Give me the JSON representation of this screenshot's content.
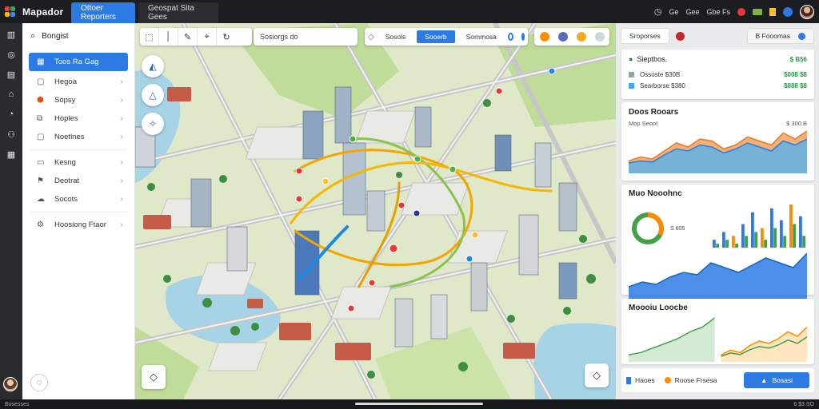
{
  "app": {
    "title": "Mapador"
  },
  "tabs": [
    {
      "label": "Ottoer Reporters",
      "active": true
    },
    {
      "label": "Geospat Sita  Gees",
      "active": false
    }
  ],
  "topbar_right": {
    "item1": "Ge",
    "item2": "Gee",
    "item3": "Gbe Fs"
  },
  "sidebar": {
    "search_label": "Bongist",
    "items": [
      {
        "label": "Toos Ra Gag",
        "icon": "grid-icon",
        "active": true
      },
      {
        "label": "Hegoa",
        "icon": "square-icon",
        "active": false
      },
      {
        "label": "Sopsy",
        "icon": "badge-icon",
        "active": false
      },
      {
        "label": "Hoples",
        "icon": "layers-icon",
        "active": false
      },
      {
        "label": "Noetlnes",
        "icon": "square-icon",
        "active": false
      },
      {
        "label": "Kesng",
        "icon": "square-icon",
        "active": false
      },
      {
        "label": "Deotrat",
        "icon": "flag-icon",
        "active": false
      },
      {
        "label": "Socots",
        "icon": "cloud-icon",
        "active": false
      },
      {
        "label": "Hoosiong Ftaor",
        "icon": "gear-icon",
        "active": false
      }
    ]
  },
  "map": {
    "search_placeholder": "Sosiorgs do",
    "seg_left": "Sosols",
    "seg_active": "Sooerb",
    "seg_right": "Sommosa"
  },
  "right_panel": {
    "header_btn": "Sroporses",
    "header_right": "B Fooomas",
    "card1": {
      "title": "Sieptbos.",
      "badge": "$ B56",
      "rows": [
        {
          "label": "Ossoste  $30B",
          "value": "$008 $8"
        },
        {
          "label": "Searborse $380",
          "value": "$888 $8"
        }
      ]
    },
    "card2": {
      "title": "Doos Rooars",
      "sub": "Mop Seoot",
      "value": "$ 300 B"
    },
    "card3": {
      "title": "Muo Nooohnc",
      "donut_label": "S 605"
    },
    "card4": {
      "title": "Moooiu Loocbe"
    },
    "footer": {
      "left": "Haoes",
      "middle": "Roose Frsesa",
      "primary": "Bosasi"
    }
  },
  "bottombar": {
    "left": "Bosesses",
    "right": "6 $3 SO"
  },
  "chart_data": [
    {
      "type": "area",
      "title": "Doos Rooars",
      "series": [
        {
          "values": [
            10,
            14,
            12,
            20,
            28,
            24,
            32,
            30,
            22,
            26,
            34,
            30,
            26,
            38,
            32,
            40
          ]
        },
        {
          "values": [
            8,
            10,
            9,
            16,
            22,
            20,
            26,
            24,
            18,
            22,
            28,
            24,
            20,
            30,
            26,
            32
          ]
        }
      ]
    },
    {
      "type": "bar",
      "title": "Muo Nooohnc",
      "series": [
        {
          "values": [
            2,
            4,
            3,
            6,
            9,
            5,
            10,
            7,
            11,
            8
          ]
        },
        {
          "values": [
            1,
            2,
            1,
            3,
            4,
            2,
            5,
            3,
            6,
            3
          ]
        }
      ]
    },
    {
      "type": "area",
      "series": [
        {
          "values": [
            4,
            6,
            5,
            8,
            10,
            9,
            14,
            12,
            10,
            13,
            16,
            14,
            12,
            18
          ]
        }
      ]
    },
    {
      "type": "line",
      "title": "Moooiu Loocbe",
      "series": [
        {
          "values": [
            2,
            3,
            5,
            7,
            9,
            12,
            14,
            18
          ]
        },
        {
          "values": [
            2,
            4,
            3,
            6,
            8,
            7,
            9,
            12,
            10,
            14
          ]
        }
      ]
    }
  ]
}
